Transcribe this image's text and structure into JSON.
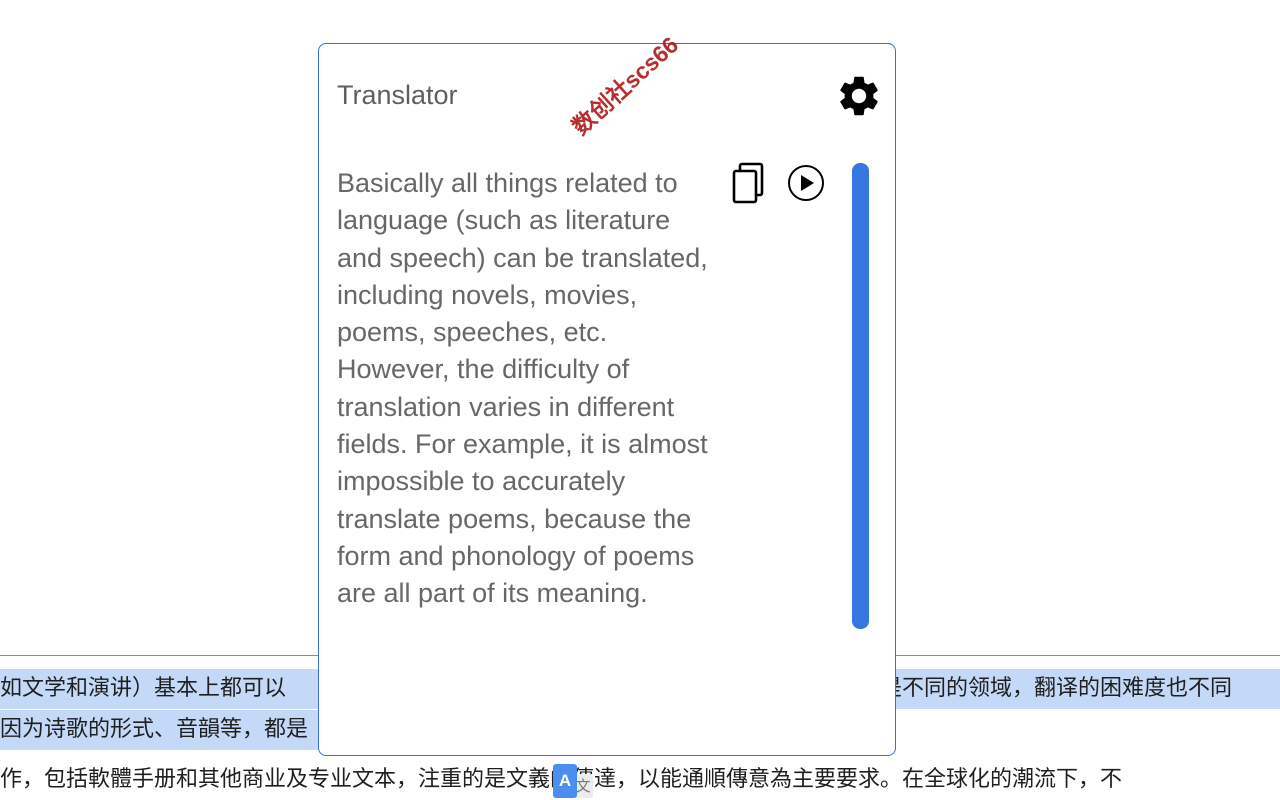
{
  "page": {
    "lines": [
      "如文学和演讲）基本上都可以",
      "因为诗歌的形式、音韻等，都是",
      "作，包括軟體手册和其他商业及专业文本，注重的是文義的傳達，以能通順傳意為主要要求。在全球化的潮流下，不"
    ],
    "line1_right": "是不同的领域，翻译的困难度也不同",
    "highlight_color": "#c4d9f7"
  },
  "translate_fab": {
    "icon": "translate-icon",
    "letter": "A",
    "glyph": "文"
  },
  "popup": {
    "title": "Translator",
    "watermark": "数创社scs66",
    "settings_icon": "gear-icon",
    "copy_icon": "copy-icon",
    "play_icon": "play-icon",
    "result_text": "Basically all things related to language (such as literature and speech) can be translated, including novels, movies, poems, speeches, etc. However, the difficulty of translation varies in different fields. For example, it is almost impossible to accurately translate poems, because the form and phonology of poems are all part of its meaning.",
    "accent_color": "#3676e0"
  }
}
